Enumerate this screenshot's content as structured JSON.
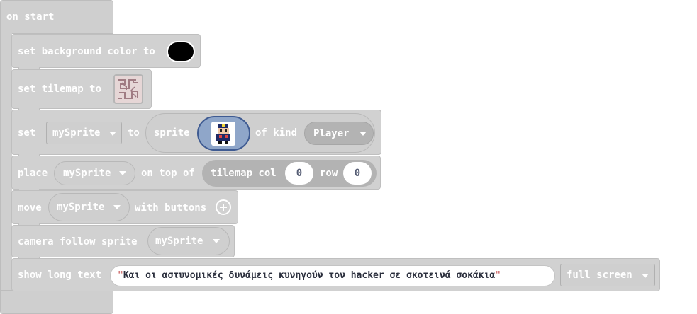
{
  "hat": {
    "label": "on start"
  },
  "blocks": {
    "bg": {
      "label": "set background color to",
      "color": "#000000"
    },
    "tilemap": {
      "label": "set tilemap to"
    },
    "setsprite": {
      "set": "set",
      "variable": "mySprite",
      "to": "to",
      "sprite": "sprite",
      "of_kind": "of kind",
      "kind": "Player"
    },
    "place": {
      "label": "place",
      "variable": "mySprite",
      "on_top_of": "on top of",
      "tilemap_col": "tilemap col",
      "col_value": "0",
      "row": "row",
      "row_value": "0"
    },
    "move": {
      "label": "move",
      "variable": "mySprite",
      "with_buttons": "with buttons"
    },
    "camera": {
      "label": "camera follow sprite",
      "variable": "mySprite"
    },
    "longtext": {
      "label": "show long text",
      "open_quote": "\"",
      "text": "Και οι αστυνομικές δυνάμεις κυνηγούν τον hacker σε σκοτεινά σοκάκια",
      "close_quote": "\"",
      "mode": "full screen"
    }
  },
  "colors": {
    "block_bg": "#d1d1d1",
    "block_border": "#bfbfbf",
    "dark_pill": "#b3b3b3",
    "sprite_slot": "#8fa6c9",
    "sprite_border": "#3f5b92",
    "quote": "#d37b7b"
  },
  "icons": [
    "tilemap-thumbnail-icon",
    "sprite-image-icon",
    "add-circle-icon",
    "dropdown-caret-icon"
  ]
}
